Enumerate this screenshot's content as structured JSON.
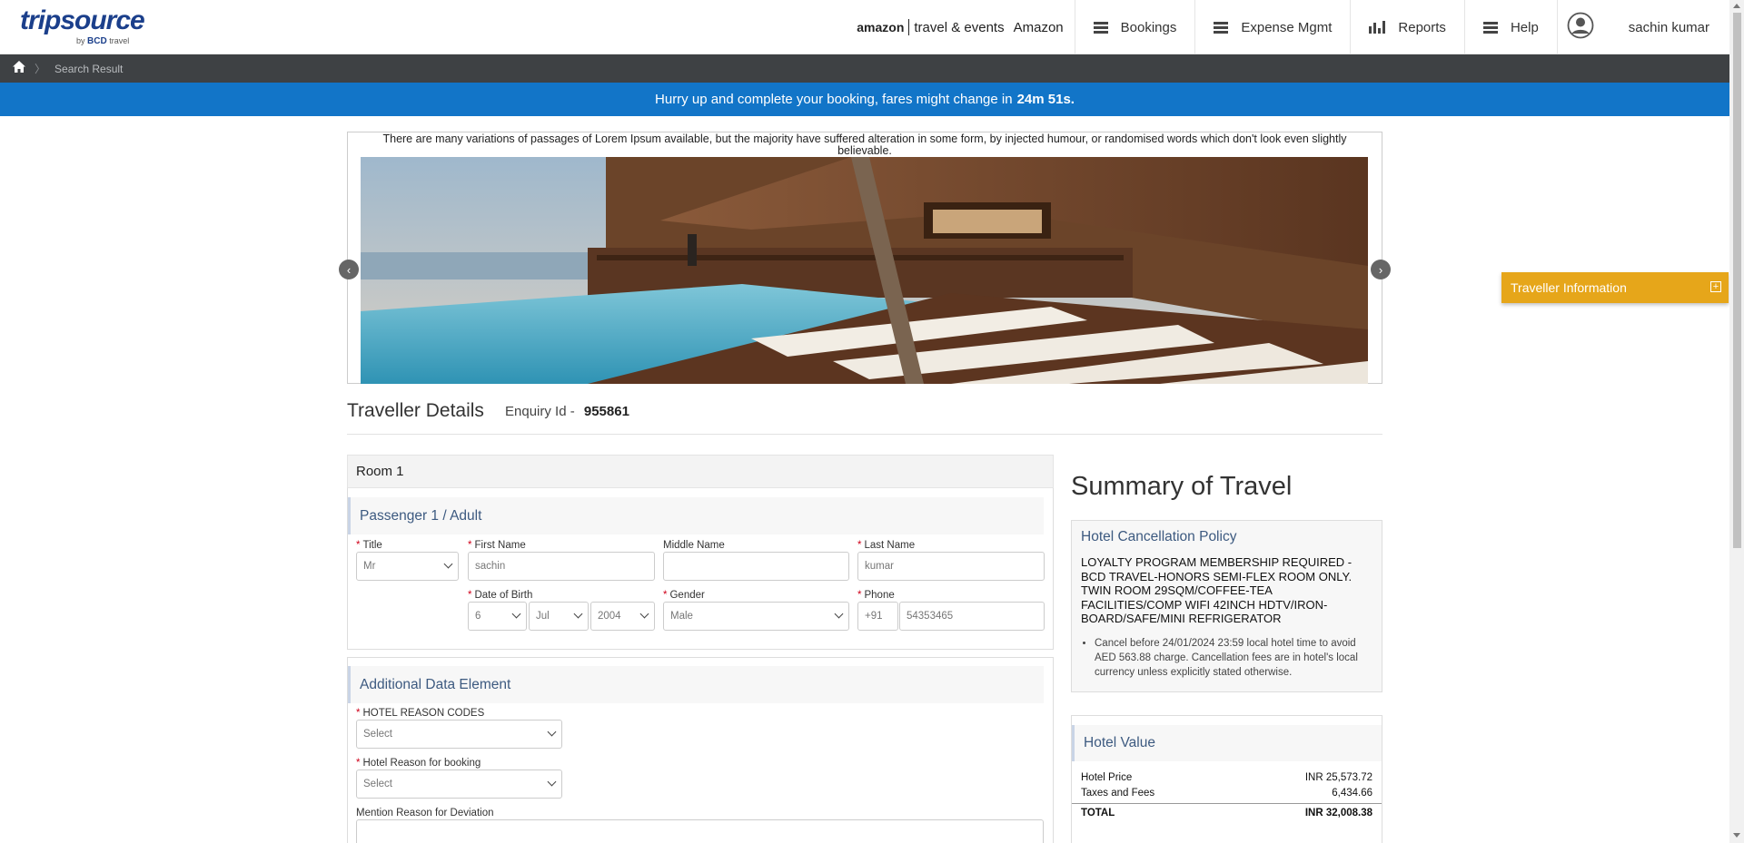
{
  "header": {
    "logo_main": "tripsource",
    "logo_by": "by",
    "logo_sub_brand": "BCD",
    "logo_sub_text": "travel",
    "amazon_logo": "amazon",
    "amazon_tag": "travel & events",
    "amazon_name": "Amazon",
    "nav": [
      {
        "label": "Bookings",
        "icon": "menu-icon"
      },
      {
        "label": "Expense Mgmt",
        "icon": "menu-icon"
      },
      {
        "label": "Reports",
        "icon": "bar-chart-icon"
      },
      {
        "label": "Help",
        "icon": "menu-icon"
      }
    ],
    "user_name": "sachin kumar"
  },
  "breadcrumb": {
    "items": [
      "Search Result"
    ]
  },
  "alert": {
    "text": "Hurry up and complete your booking, fares might change in",
    "countdown": "24m 51s."
  },
  "carousel": {
    "caption": "There are many variations of passages of Lorem Ipsum available, but the majority have suffered alteration in some form, by injected humour, or randomised words which don't look even slightly believable."
  },
  "traveller_details": {
    "title": "Traveller Details",
    "enquiry_label": "Enquiry Id -",
    "enquiry_id": "955861"
  },
  "room": {
    "title": "Room 1",
    "passenger_heading": "Passenger 1 / Adult",
    "fields": {
      "title_label": "Title",
      "title_value": "Mr",
      "first_name_label": "First Name",
      "first_name_value": "sachin",
      "middle_name_label": "Middle Name",
      "middle_name_value": "",
      "last_name_label": "Last Name",
      "last_name_value": "kumar",
      "dob_label": "Date of Birth",
      "dob_day": "6",
      "dob_month": "Jul",
      "dob_year": "2004",
      "gender_label": "Gender",
      "gender_value": "Male",
      "phone_label": "Phone",
      "phone_code": "+91",
      "phone_value": "54353465"
    }
  },
  "additional": {
    "heading": "Additional Data Element",
    "reason_codes_label": "HOTEL REASON CODES",
    "reason_codes_value": "Select",
    "reason_booking_label": "Hotel Reason for booking",
    "reason_booking_value": "Select",
    "deviation_label": "Mention Reason for Deviation"
  },
  "summary": {
    "title": "Summary of Travel",
    "policy_heading": "Hotel Cancellation Policy",
    "policy_text": "LOYALTY PROGRAM MEMBERSHIP REQUIRED - BCD TRAVEL-HONORS SEMI-FLEX ROOM ONLY. TWIN ROOM 29SQM/COFFEE-TEA FACILITIES/COMP WIFI 42INCH HDTV/IRON-BOARD/SAFE/MINI REFRIGERATOR",
    "policy_bullet": "Cancel before 24/01/2024 23:59 local hotel time to avoid AED 563.88 charge. Cancellation fees are in hotel's local currency unless explicitly stated otherwise.",
    "value_heading": "Hotel Value",
    "rows": [
      {
        "label": "Hotel Price",
        "value": "INR 25,573.72"
      },
      {
        "label": "Taxes and Fees",
        "value": "6,434.66"
      }
    ],
    "total_label": "TOTAL",
    "total_value": "INR 32,008.38"
  },
  "traveller_tab": {
    "label": "Traveller Information",
    "toggle": "+"
  },
  "colors": {
    "alert_bg": "#1275c8",
    "breadcrumb_bg": "#3e4144",
    "tab_bg": "#e6a61a",
    "section_heading": "#3d5a80"
  }
}
